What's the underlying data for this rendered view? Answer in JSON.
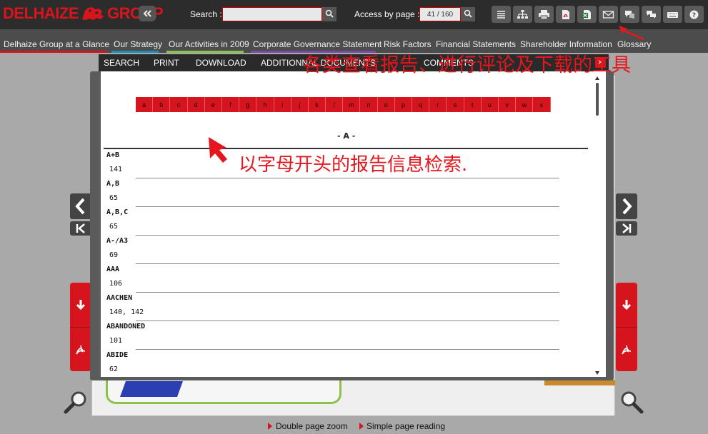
{
  "brand": {
    "logo_left": "DELHAIZE",
    "logo_right": "GROUP"
  },
  "toolbar": {
    "search_label": "Search :",
    "search_value": "",
    "page_label": "Access by page :",
    "page_value": "41 / 160",
    "tools": [
      "list-icon",
      "sitemap-icon",
      "print-icon",
      "pdf-icon",
      "excel-icon",
      "mail-icon",
      "comment-icon",
      "comments-icon",
      "keyboard-icon",
      "help-icon"
    ]
  },
  "nav": [
    {
      "label": "Delhaize Group at a Glance",
      "color": "#d6141d"
    },
    {
      "label": "Our Strategy",
      "color": "#1e8fb8"
    },
    {
      "label": "Our Activities in 2009",
      "color": "#8bc34a"
    },
    {
      "label": "Corporate Governance Statement",
      "color": "#7a4aa8"
    },
    {
      "label": "Risk Factors",
      "color": "#4c4c4c"
    },
    {
      "label": "Financial Statements",
      "color": "#4c4c4c"
    },
    {
      "label": "Shareholder Information",
      "color": "#4c4c4c"
    },
    {
      "label": "Glossary",
      "color": "#4c4c4c"
    }
  ],
  "dialog": {
    "tabs": [
      "SEARCH",
      "PRINT",
      "DOWNLOAD",
      "ADDITIONNAL DOCUMENTS",
      "COMMENTS"
    ],
    "close": "×",
    "letters": [
      "a",
      "b",
      "c",
      "d",
      "e",
      "f",
      "g",
      "h",
      "i",
      "j",
      "k",
      "l",
      "m",
      "n",
      "o",
      "p",
      "q",
      "r",
      "s",
      "t",
      "u",
      "v",
      "w",
      "x"
    ],
    "section": "- A -",
    "entries": [
      {
        "term": "A+B",
        "pages": "141"
      },
      {
        "term": "A,B",
        "pages": "65"
      },
      {
        "term": "A,B,C",
        "pages": "65"
      },
      {
        "term": "A-/A3",
        "pages": "69"
      },
      {
        "term": "AAA",
        "pages": "106"
      },
      {
        "term": "AACHEN",
        "pages": "140, 142"
      },
      {
        "term": "ABANDONED",
        "pages": "101"
      },
      {
        "term": "ABIDE",
        "pages": "62"
      }
    ]
  },
  "annotations": {
    "top": "各类查看报告、进行评论及下载的工具",
    "middle": "以字母开头的报告信息检索."
  },
  "bottom": {
    "zoom": "Double page zoom",
    "reading": "Simple page reading"
  },
  "colors": {
    "accent": "#d6141d",
    "topbar": "#2c2c2c",
    "navbar": "#4c4c4c"
  }
}
